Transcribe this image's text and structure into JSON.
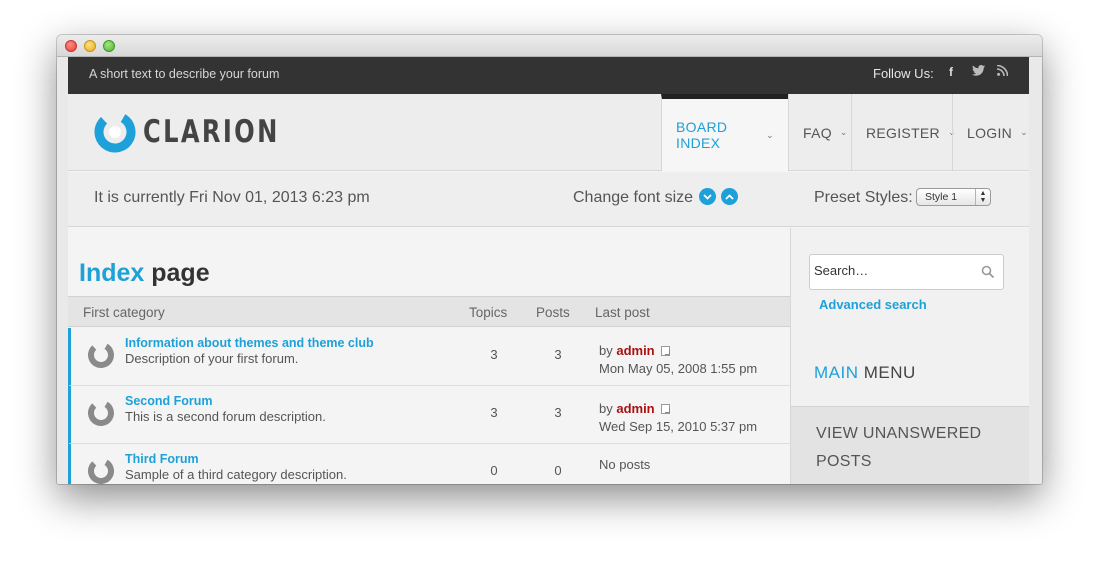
{
  "window": {
    "controls": [
      "close",
      "minimize",
      "zoom"
    ]
  },
  "topbar": {
    "tagline": "A short text to describe your forum",
    "follow_label": "Follow Us:",
    "social_icons": [
      "facebook-icon",
      "twitter-icon",
      "rss-icon"
    ],
    "social_glyphs": {
      "facebook": "f",
      "twitter": "🐦",
      "rss": "))"
    }
  },
  "header": {
    "logo_text": "CLARION",
    "nav": [
      {
        "label": "BOARD INDEX",
        "active": true
      },
      {
        "label": "FAQ",
        "active": false
      },
      {
        "label": "REGISTER",
        "active": false
      },
      {
        "label": "LOGIN",
        "active": false
      }
    ],
    "chevron": "⌄"
  },
  "infobar": {
    "current_time": "It is currently Fri Nov 01, 2013 6:23 pm",
    "font_size_label": "Change font size",
    "font_down_glyph": "⌄",
    "font_up_glyph": "⌃",
    "preset_label": "Preset Styles:",
    "preset_value": "Style 1"
  },
  "main": {
    "title_accent": "Index",
    "title_rest": " page",
    "table": {
      "headers": {
        "category": "First category",
        "topics": "Topics",
        "posts": "Posts",
        "last_post": "Last post"
      },
      "rows": [
        {
          "title": "Information about themes and theme club",
          "description": "Description of your first forum.",
          "topics": "3",
          "posts": "3",
          "last_by": "by ",
          "last_author": "admin",
          "last_date": "Mon May 05, 2008 1:55 pm"
        },
        {
          "title": "Second Forum",
          "description": "This is a second forum description.",
          "topics": "3",
          "posts": "3",
          "last_by": "by ",
          "last_author": "admin",
          "last_date": "Wed Sep 15, 2010 5:37 pm"
        },
        {
          "title": "Third Forum",
          "description": "Sample of a third category description.",
          "topics": "0",
          "posts": "0",
          "no_posts": "No posts"
        }
      ]
    }
  },
  "sidebar": {
    "search_placeholder": "Search…",
    "advanced_search": "Advanced search",
    "menu_title_accent": "MAIN",
    "menu_title_rest": " MENU",
    "menu_items": [
      "VIEW UNANSWERED POSTS"
    ]
  },
  "colors": {
    "accent": "#1da1d8",
    "topbar": "#333333",
    "author": "#aa1111"
  }
}
